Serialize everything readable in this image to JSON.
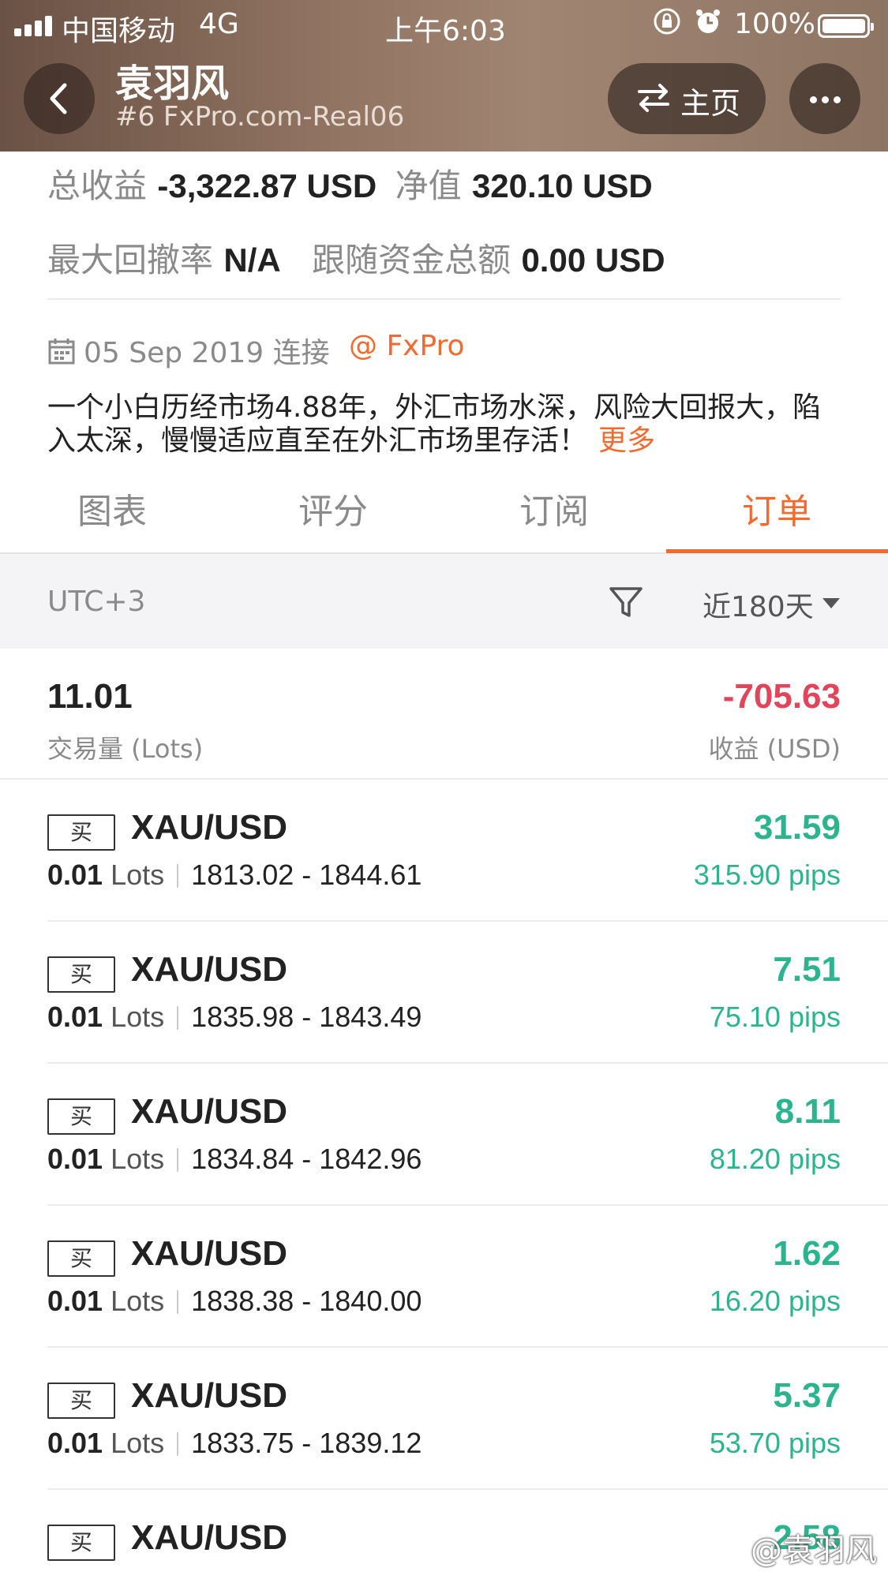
{
  "status_bar": {
    "carrier": "中国移动",
    "network": "4G",
    "time": "上午6:03",
    "battery": "100%"
  },
  "header": {
    "title": "袁羽风",
    "subtitle": "#6 FxPro.com-Real06",
    "home_label": "主页"
  },
  "stats": {
    "total_profit_label": "总收益",
    "total_profit_value": "-3,322.87 USD",
    "equity_label": "净值",
    "equity_value": "320.10 USD",
    "max_drawdown_label": "最大回撤率",
    "max_drawdown_value": "N/A",
    "follower_funds_label": "跟随资金总额",
    "follower_funds_value": "0.00 USD"
  },
  "info": {
    "connected": "05 Sep 2019 连接",
    "broker": "@ FxPro",
    "description": "一个小白历经市场4.88年，外汇市场水深，风险大回报大，陷入太深，慢慢适应直至在外汇市场里存活！",
    "more_label": "更多"
  },
  "tabs": [
    "图表",
    "评分",
    "订阅",
    "订单"
  ],
  "active_tab": 3,
  "filter": {
    "timezone": "UTC+3",
    "period": "近180天"
  },
  "summary": {
    "lots": "11.01",
    "lots_label": "交易量 (Lots)",
    "profit": "-705.63",
    "profit_label": "收益 (USD)"
  },
  "orders": [
    {
      "side": "买",
      "symbol": "XAU/USD",
      "lots": "0.01",
      "unit": "Lots",
      "range": "1813.02 - 1844.61",
      "profit": "31.59",
      "pips": "315.90 pips"
    },
    {
      "side": "买",
      "symbol": "XAU/USD",
      "lots": "0.01",
      "unit": "Lots",
      "range": "1835.98 - 1843.49",
      "profit": "7.51",
      "pips": "75.10 pips"
    },
    {
      "side": "买",
      "symbol": "XAU/USD",
      "lots": "0.01",
      "unit": "Lots",
      "range": "1834.84 - 1842.96",
      "profit": "8.11",
      "pips": "81.20 pips"
    },
    {
      "side": "买",
      "symbol": "XAU/USD",
      "lots": "0.01",
      "unit": "Lots",
      "range": "1838.38 - 1840.00",
      "profit": "1.62",
      "pips": "16.20 pips"
    },
    {
      "side": "买",
      "symbol": "XAU/USD",
      "lots": "0.01",
      "unit": "Lots",
      "range": "1833.75 - 1839.12",
      "profit": "5.37",
      "pips": "53.70 pips"
    },
    {
      "side": "买",
      "symbol": "XAU/USD",
      "profit": "2.58"
    }
  ],
  "watermark": "@袁羽风",
  "colors": {
    "accent": "#f26a2e",
    "profit_positive": "#2cb48e",
    "profit_negative": "#e0455a"
  }
}
